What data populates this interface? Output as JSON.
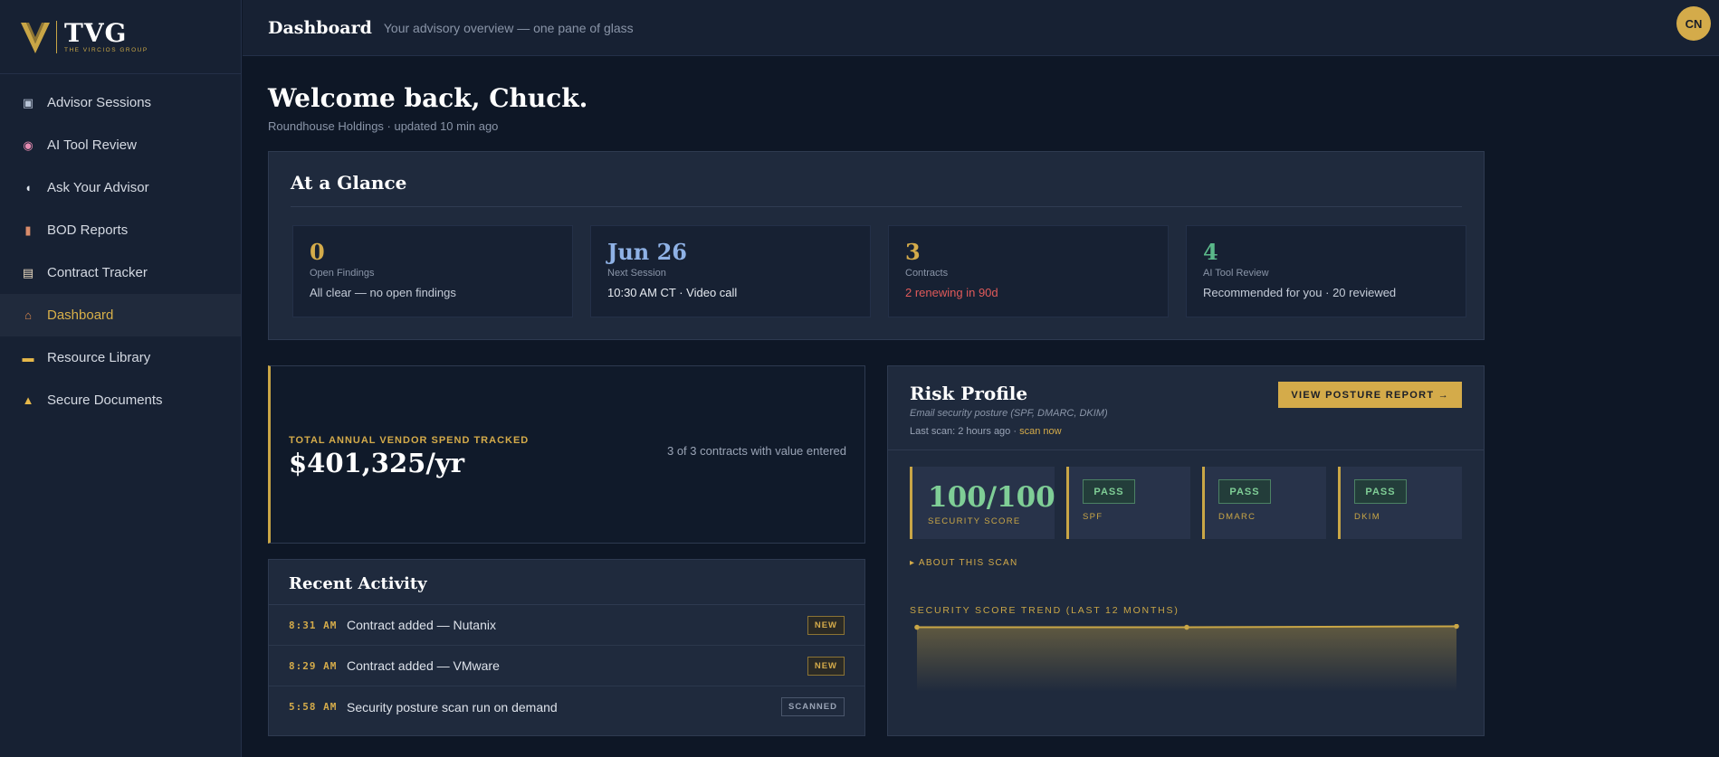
{
  "brand": {
    "logo_text": "TVG",
    "tagline": "THE VIRCIOS GROUP"
  },
  "sidebar": {
    "items": [
      {
        "label": "Advisor Sessions",
        "icon": "calendar-icon",
        "active": false
      },
      {
        "label": "AI Tool Review",
        "icon": "robot-icon",
        "active": false
      },
      {
        "label": "Ask Your Advisor",
        "icon": "speech-bubble-icon",
        "active": false
      },
      {
        "label": "BOD Reports",
        "icon": "bar-chart-icon",
        "active": false
      },
      {
        "label": "Contract Tracker",
        "icon": "clipboard-icon",
        "active": false
      },
      {
        "label": "Dashboard",
        "icon": "house-icon",
        "active": true
      },
      {
        "label": "Resource Library",
        "icon": "folder-icon",
        "active": false
      },
      {
        "label": "Secure Documents",
        "icon": "lock-icon",
        "active": false
      }
    ]
  },
  "header": {
    "title": "Dashboard",
    "subtitle": "Your advisory overview — one pane of glass",
    "avatar_initials": "CN"
  },
  "welcome": {
    "title": "Welcome back, Chuck.",
    "subtitle": "Roundhouse Holdings · updated 10 min ago"
  },
  "glance": {
    "title": "At a Glance",
    "stats": [
      {
        "value": "0",
        "label": "Open Findings",
        "desc": "All clear — no open findings",
        "value_color": "#d4ab4a",
        "desc_color": "#c5ccd8"
      },
      {
        "value": "Jun 26",
        "label": "Next Session",
        "desc": "10:30 AM CT · Video call",
        "value_color": "#8fb2e6",
        "desc_color": "#e6eaf0"
      },
      {
        "value": "3",
        "label": "Contracts",
        "desc": "2 renewing in 90d",
        "value_color": "#d4ab4a",
        "desc_color": "#e05a5a"
      },
      {
        "value": "4",
        "label": "AI Tool Review",
        "desc": "Recommended for you · 20 reviewed",
        "value_color": "#5bb98a",
        "desc_color": "#c5ccd8"
      }
    ]
  },
  "spend": {
    "label": "TOTAL ANNUAL VENDOR SPEND TRACKED",
    "value": "$401,325/yr",
    "note": "3 of 3 contracts with value entered"
  },
  "activity": {
    "title": "Recent Activity",
    "rows": [
      {
        "time": "8:31 AM",
        "text": "Contract added — Nutanix",
        "badge": "NEW",
        "badge_type": "new"
      },
      {
        "time": "8:29 AM",
        "text": "Contract added — VMware",
        "badge": "NEW",
        "badge_type": "new"
      },
      {
        "time": "5:58 AM",
        "text": "Security posture scan run on demand",
        "badge": "SCANNED",
        "badge_type": "scanned"
      }
    ]
  },
  "risk": {
    "title": "Risk Profile",
    "subtitle": "Email security posture (SPF, DMARC, DKIM)",
    "last_scan": "Last scan: 2 hours ago · ",
    "scan_link": "scan now",
    "button": "VIEW POSTURE REPORT →",
    "score": "100/100",
    "score_label": "SECURITY SCORE",
    "checks": [
      {
        "status": "PASS",
        "label": "SPF"
      },
      {
        "status": "PASS",
        "label": "DMARC"
      },
      {
        "status": "PASS",
        "label": "DKIM"
      }
    ],
    "about": "▸ ABOUT THIS SCAN",
    "trend_title": "SECURITY SCORE TREND (LAST 12 MONTHS)"
  },
  "chart_data": {
    "type": "area",
    "x": [
      1,
      2,
      3
    ],
    "values": [
      98,
      98,
      100
    ],
    "ylim": [
      0,
      110
    ],
    "color": "#c9a646"
  }
}
